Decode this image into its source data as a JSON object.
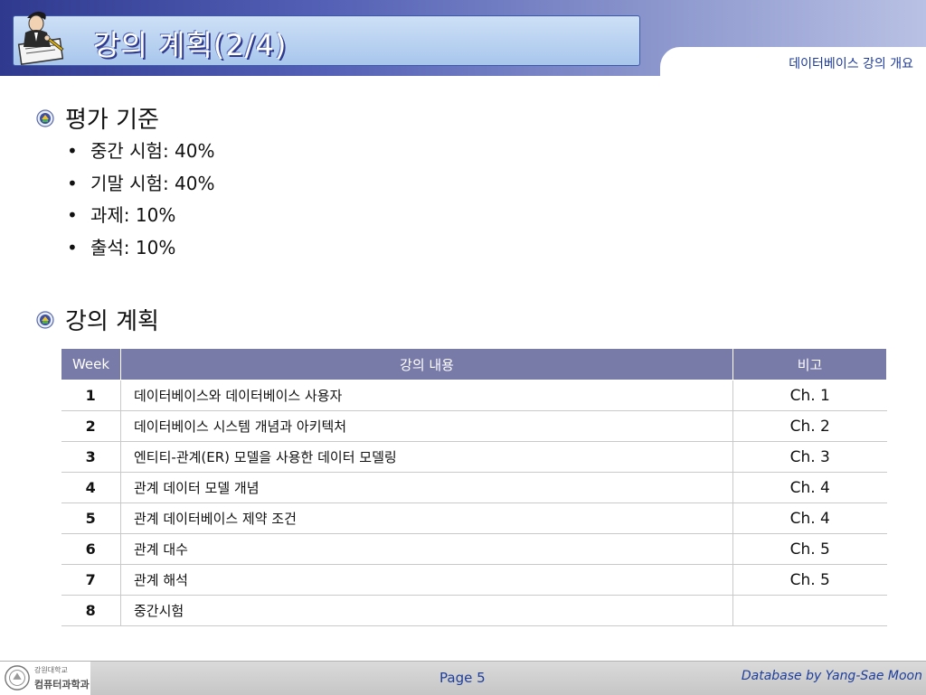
{
  "header": {
    "title": "강의 계획(2/4)",
    "subtitle": "데이터베이스 강의 개요"
  },
  "sections": {
    "evaluation": {
      "title": "평가 기준",
      "items": [
        "중간 시험: 40%",
        "기말 시험: 40%",
        "과제: 10%",
        "출석: 10%"
      ]
    },
    "plan": {
      "title": "강의 계획"
    }
  },
  "table": {
    "headers": [
      "Week",
      "강의 내용",
      "비고"
    ],
    "rows": [
      {
        "week": "1",
        "content": "데이터베이스와 데이터베이스 사용자",
        "note": "Ch. 1"
      },
      {
        "week": "2",
        "content": "데이터베이스 시스템 개념과 아키텍처",
        "note": "Ch. 2"
      },
      {
        "week": "3",
        "content": "엔티티-관계(ER) 모델을 사용한 데이터 모델링",
        "note": "Ch. 3"
      },
      {
        "week": "4",
        "content": "관계 데이터 모델 개념",
        "note": "Ch. 4"
      },
      {
        "week": "5",
        "content": "관계 데이터베이스 제약 조건",
        "note": "Ch. 4"
      },
      {
        "week": "6",
        "content": "관계 대수",
        "note": "Ch. 5"
      },
      {
        "week": "7",
        "content": "관계 해석",
        "note": "Ch. 5"
      },
      {
        "week": "8",
        "content": "중간시험",
        "note": ""
      }
    ]
  },
  "footer": {
    "logo_text_1": "강원대학교",
    "logo_text_2": "컴퓨터과학과",
    "page": "Page 5",
    "credit": "Database by Yang-Sae Moon"
  },
  "colors": {
    "header_dark": "#2f3a8f",
    "table_header": "#787aa8",
    "link_blue": "#1f3e9a"
  }
}
